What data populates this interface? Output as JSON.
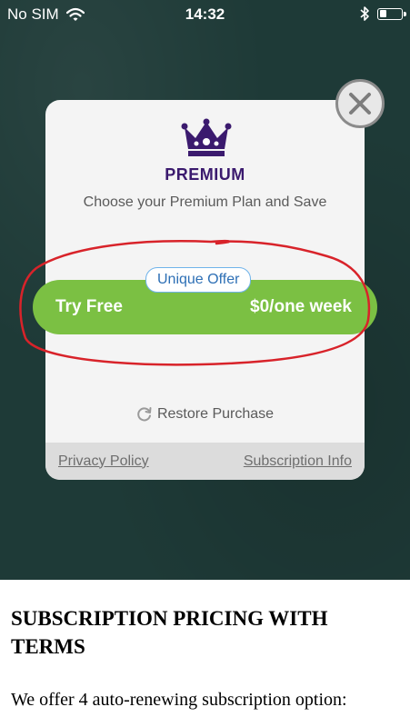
{
  "status_bar": {
    "carrier": "No SIM",
    "time": "14:32",
    "icons": [
      "wifi-icon",
      "bluetooth-icon",
      "battery-icon"
    ]
  },
  "modal": {
    "close_icon": "close-icon",
    "crown_icon": "crown-icon",
    "title": "PREMIUM",
    "subtitle": "Choose your Premium Plan and Save",
    "offer_badge": "Unique Offer",
    "try_button": {
      "label": "Try Free",
      "price": "$0/one week"
    },
    "restore_label": "Restore Purchase",
    "footer": {
      "privacy_label": "Privacy Policy",
      "subscription_label": "Subscription Info"
    }
  },
  "article": {
    "heading": "SUBSCRIPTION PRICING WITH TERMS",
    "body": "We offer 4 auto-renewing subscription option:"
  },
  "colors": {
    "app_background": "#1e3a37",
    "brand_purple": "#3b1a6e",
    "button_green": "#7bc043",
    "annotation_red": "#d8232a"
  }
}
